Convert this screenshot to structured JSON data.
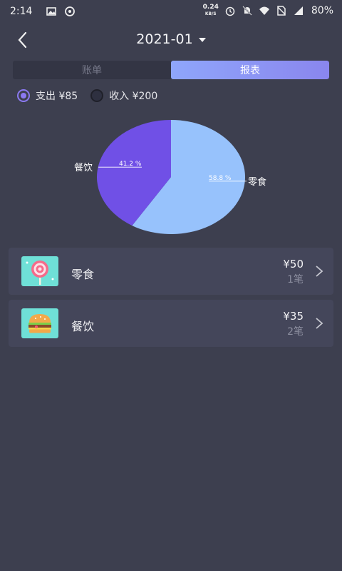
{
  "status_bar": {
    "time": "2:14",
    "net_speed": "0.24",
    "net_unit": "KB/S",
    "battery": "80%"
  },
  "header": {
    "month": "2021-01"
  },
  "tabs": [
    {
      "label": "账单",
      "active": false
    },
    {
      "label": "报表",
      "active": true
    }
  ],
  "toggle": {
    "expense_label": "支出 ¥85",
    "income_label": "收入 ¥200",
    "selected": "expense"
  },
  "chart_data": {
    "type": "pie",
    "slices": [
      {
        "label": "零食",
        "value": 58.8,
        "percent_label": "58.8 %",
        "color": "#97c2fc"
      },
      {
        "label": "餐饮",
        "value": 41.2,
        "percent_label": "41.2 %",
        "color": "#7050e6"
      }
    ]
  },
  "categories": [
    {
      "name": "零食",
      "amount": "¥50",
      "count": "1笔",
      "icon": "lollipop-icon"
    },
    {
      "name": "餐饮",
      "amount": "¥35",
      "count": "2笔",
      "icon": "burger-icon"
    }
  ]
}
